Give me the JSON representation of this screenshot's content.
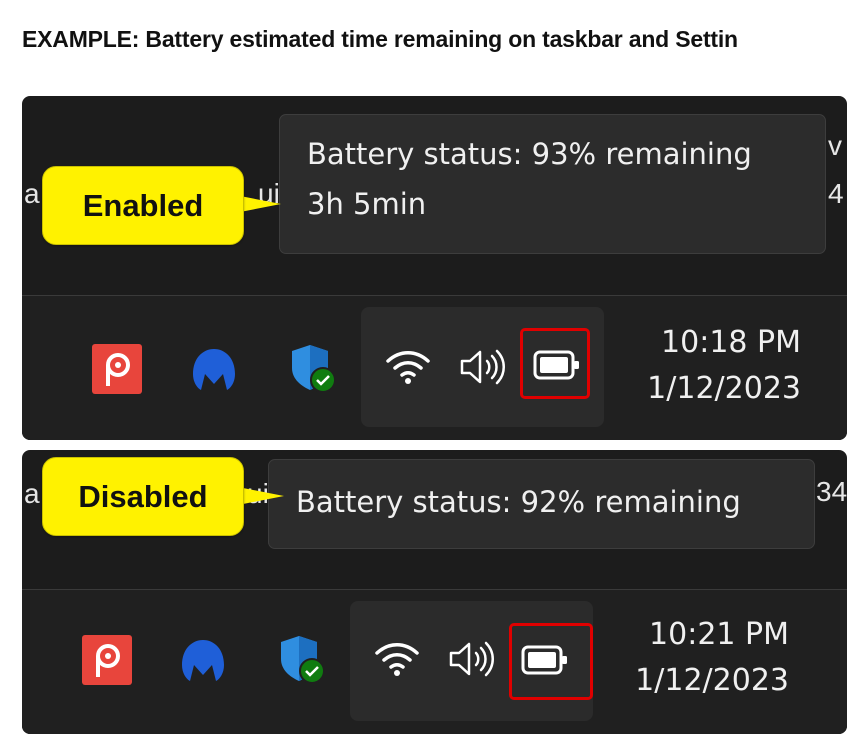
{
  "heading": "EXAMPLE: Battery estimated time remaining on taskbar and Settin",
  "panels": [
    {
      "callout": "Enabled",
      "tooltip": {
        "line1": "Battery status: 93% remaining",
        "line2": "3h 5min"
      },
      "clock": {
        "time": "10:18 PM",
        "date": "1/12/2023"
      },
      "bg_fragments": {
        "left": "a",
        "mid": "uil",
        "right_top": "v",
        "right_mid": "4"
      }
    },
    {
      "callout": "Disabled",
      "tooltip": {
        "line1": "Battery status: 92% remaining"
      },
      "clock": {
        "time": "10:21 PM",
        "date": "1/12/2023"
      },
      "bg_fragments": {
        "left": "a",
        "mid": "ui",
        "right_mid": "34"
      }
    }
  ],
  "icons": {
    "app1": "pushbullet-icon",
    "app2": "malwarebytes-icon",
    "app3": "windows-security-icon",
    "wifi": "wifi-icon",
    "volume": "volume-icon",
    "battery": "battery-icon"
  },
  "colors": {
    "callout": "#fff200",
    "highlight": "#e00000",
    "taskbar": "#202020",
    "tooltip": "#2c2c2c"
  }
}
